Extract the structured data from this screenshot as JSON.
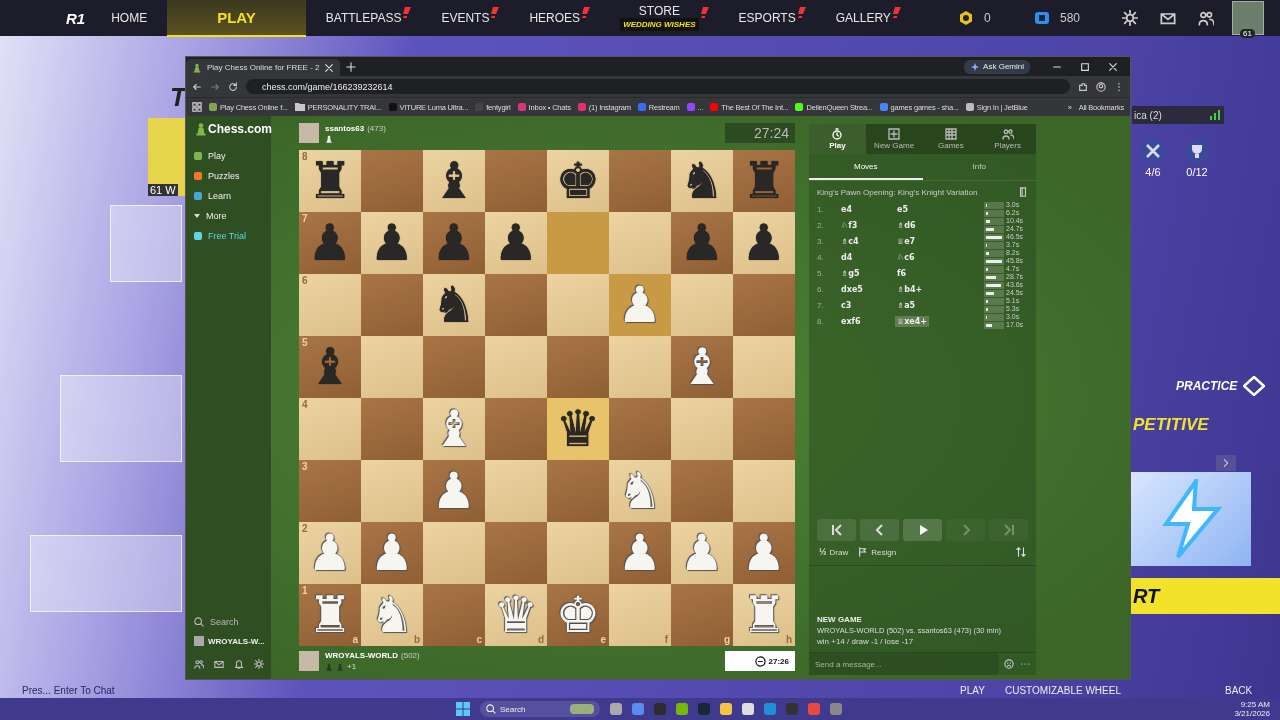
{
  "game_bar": {
    "logo": "R1",
    "nav": [
      {
        "label": "HOME",
        "selected": false,
        "alert": false
      },
      {
        "label": "PLAY",
        "selected": true,
        "alert": false
      },
      {
        "label": "BATTLEPASS",
        "selected": false,
        "alert": true
      },
      {
        "label": "EVENTS",
        "selected": false,
        "alert": true
      },
      {
        "label": "HEROES",
        "selected": false,
        "alert": true
      },
      {
        "label": "STORE",
        "sub": "WEDDING WISHES",
        "selected": false,
        "alert": true
      },
      {
        "label": "ESPORTS",
        "selected": false,
        "alert": true
      },
      {
        "label": "GALLERY",
        "selected": false,
        "alert": true
      }
    ],
    "currencies": [
      "0",
      "580"
    ],
    "level": "61"
  },
  "game_background": {
    "left_letter": "T",
    "left_card": "61 W",
    "friend": "ica (2)",
    "counters": [
      "4/6",
      "0/12"
    ],
    "practice": "PRACTICE",
    "competitive": "PETITIVE",
    "start": "RT",
    "bottom_hints": [
      "Pres... Enter To Chat",
      "PLAY",
      "CUSTOMIZABLE WHEEL",
      "BACK"
    ]
  },
  "browser": {
    "tab_title": "Play Chess Online for FREE - 2",
    "gemini": "Ask Gemini",
    "url": "chess.com/game/166239232614",
    "bookmarks": [
      {
        "label": "Play Chess Online f...",
        "kind": "site",
        "color": "#7fa650"
      },
      {
        "label": "PERSONALITY TRAI...",
        "kind": "folder",
        "color": "#c8c8c8"
      },
      {
        "label": "VITURE Luma Ultra...",
        "kind": "site",
        "color": "#111111"
      },
      {
        "label": "fentygirl",
        "kind": "site",
        "color": "#444444"
      },
      {
        "label": "Inbox • Chats",
        "kind": "site",
        "color": "#d6367a"
      },
      {
        "label": "(1) Instagram",
        "kind": "site",
        "color": "#e1306c"
      },
      {
        "label": "Restream",
        "kind": "site",
        "color": "#3b6cf6"
      },
      {
        "label": "...",
        "kind": "site",
        "color": "#9146ff"
      },
      {
        "label": "The Best Of The Int...",
        "kind": "site",
        "color": "#ff0000"
      },
      {
        "label": "DeilenQueen Strea...",
        "kind": "site",
        "color": "#53fc18"
      },
      {
        "label": "games games - sha...",
        "kind": "site",
        "color": "#4285f4"
      },
      {
        "label": "Sign In | JetBlue",
        "kind": "site",
        "color": "#bbbbbb"
      }
    ],
    "more": "»",
    "all_bookmarks": "All Bookmarks"
  },
  "chess": {
    "logo": "Chess.com",
    "nav": [
      {
        "label": "Play",
        "kind": "play"
      },
      {
        "label": "Puzzles",
        "kind": "puzzles"
      },
      {
        "label": "Learn",
        "kind": "learn"
      },
      {
        "label": "More",
        "kind": "more"
      },
      {
        "label": "Free Trial",
        "kind": "trial"
      }
    ],
    "search": "Search",
    "user": "WROYALS-W...",
    "top_player": {
      "name": "ssantos63",
      "rating": "(473)",
      "clock": "27:24",
      "active": false
    },
    "bottom_player": {
      "name": "WROYALS-WORLD",
      "rating": "(502)",
      "extra": "+1",
      "clock": "27:26",
      "active": true
    },
    "files": [
      "a",
      "b",
      "c",
      "d",
      "e",
      "f",
      "g",
      "h"
    ],
    "ranks": [
      {
        "label": "8",
        "squares": [
          {
            "piece": "♜",
            "white": false,
            "highlighted": false
          },
          {
            "highlighted": false
          },
          {
            "piece": "♝",
            "white": false,
            "highlighted": false
          },
          {
            "highlighted": false
          },
          {
            "piece": "♚",
            "white": false,
            "highlighted": false
          },
          {
            "highlighted": false
          },
          {
            "piece": "♞",
            "white": false,
            "highlighted": false
          },
          {
            "piece": "♜",
            "white": false,
            "highlighted": false
          }
        ]
      },
      {
        "label": "7",
        "squares": [
          {
            "piece": "♟",
            "white": false,
            "highlighted": false
          },
          {
            "piece": "♟",
            "white": false,
            "highlighted": false
          },
          {
            "piece": "♟",
            "white": false,
            "highlighted": false
          },
          {
            "piece": "♟",
            "white": false,
            "highlighted": false
          },
          {
            "highlighted": true
          },
          {
            "highlighted": false
          },
          {
            "piece": "♟",
            "white": false,
            "highlighted": false
          },
          {
            "piece": "♟",
            "white": false,
            "highlighted": false
          }
        ]
      },
      {
        "label": "6",
        "squares": [
          {
            "highlighted": false
          },
          {
            "highlighted": false
          },
          {
            "piece": "♞",
            "white": false,
            "highlighted": false
          },
          {
            "highlighted": false
          },
          {
            "highlighted": false
          },
          {
            "piece": "♟",
            "white": true,
            "highlighted": true
          },
          {
            "highlighted": false
          },
          {
            "highlighted": false
          }
        ]
      },
      {
        "label": "5",
        "squares": [
          {
            "piece": "♝",
            "white": false,
            "highlighted": false
          },
          {
            "highlighted": false
          },
          {
            "highlighted": false
          },
          {
            "highlighted": false
          },
          {
            "highlighted": false
          },
          {
            "highlighted": false
          },
          {
            "piece": "♝",
            "white": true,
            "highlighted": false
          },
          {
            "highlighted": false
          }
        ]
      },
      {
        "label": "4",
        "squares": [
          {
            "highlighted": false
          },
          {
            "highlighted": false
          },
          {
            "piece": "♝",
            "white": true,
            "highlighted": false
          },
          {
            "highlighted": false
          },
          {
            "piece": "♛",
            "white": false,
            "highlighted": true
          },
          {
            "highlighted": false
          },
          {
            "highlighted": false
          },
          {
            "highlighted": false
          }
        ]
      },
      {
        "label": "3",
        "squares": [
          {
            "highlighted": false
          },
          {
            "highlighted": false
          },
          {
            "piece": "♟",
            "white": true,
            "highlighted": false
          },
          {
            "highlighted": false
          },
          {
            "highlighted": false
          },
          {
            "piece": "♞",
            "white": true,
            "highlighted": false
          },
          {
            "highlighted": false
          },
          {
            "highlighted": false
          }
        ]
      },
      {
        "label": "2",
        "squares": [
          {
            "piece": "♟",
            "white": true,
            "highlighted": false
          },
          {
            "piece": "♟",
            "white": true,
            "highlighted": false
          },
          {
            "highlighted": false
          },
          {
            "highlighted": false
          },
          {
            "highlighted": false
          },
          {
            "piece": "♟",
            "white": true,
            "highlighted": false
          },
          {
            "piece": "♟",
            "white": true,
            "highlighted": false
          },
          {
            "piece": "♟",
            "white": true,
            "highlighted": false
          }
        ]
      },
      {
        "label": "1",
        "squares": [
          {
            "piece": "♜",
            "white": true,
            "highlighted": false
          },
          {
            "piece": "♞",
            "white": true,
            "highlighted": false
          },
          {
            "highlighted": false
          },
          {
            "piece": "♛",
            "white": true,
            "highlighted": false
          },
          {
            "piece": "♚",
            "white": true,
            "highlighted": false
          },
          {
            "highlighted": false
          },
          {
            "highlighted": false
          },
          {
            "piece": "♜",
            "white": true,
            "highlighted": false
          }
        ]
      }
    ],
    "panel": {
      "tabs": [
        {
          "label": "Play",
          "kind": "play",
          "selected": true
        },
        {
          "label": "New Game",
          "kind": "new",
          "selected": false
        },
        {
          "label": "Games",
          "kind": "games",
          "selected": false
        },
        {
          "label": "Players",
          "kind": "players",
          "selected": false
        }
      ],
      "subtabs": [
        {
          "label": "Moves",
          "selected": true
        },
        {
          "label": "Info",
          "selected": false
        }
      ],
      "opening": "King's Pawn Opening: King's Knight Variation",
      "moves": [
        {
          "no": "1.",
          "white": {
            "san": "e4",
            "selected": false
          },
          "black": {
            "san": "e5",
            "selected": false
          },
          "times": [
            {
              "text": "3.0s",
              "level": 0.06
            },
            {
              "text": "6.2s",
              "level": 0.13
            }
          ]
        },
        {
          "no": "2.",
          "white": {
            "san": "♘f3",
            "selected": false
          },
          "black": {
            "san": "♗d6",
            "selected": false
          },
          "times": [
            {
              "text": "10.4s",
              "level": 0.22
            },
            {
              "text": "24.7s",
              "level": 0.53
            }
          ]
        },
        {
          "no": "3.",
          "white": {
            "san": "♗c4",
            "selected": false
          },
          "black": {
            "san": "♕e7",
            "selected": false
          },
          "times": [
            {
              "text": "46.5s",
              "level": 1
            },
            {
              "text": "3.7s",
              "level": 0.08
            }
          ]
        },
        {
          "no": "4.",
          "white": {
            "san": "d4",
            "selected": false
          },
          "black": {
            "san": "♘c6",
            "selected": false
          },
          "times": [
            {
              "text": "8.2s",
              "level": 0.18
            },
            {
              "text": "45.8s",
              "level": 0.98
            }
          ]
        },
        {
          "no": "5.",
          "white": {
            "san": "♗g5",
            "selected": false
          },
          "black": {
            "san": "f6",
            "selected": false
          },
          "times": [
            {
              "text": "4.7s",
              "level": 0.1
            },
            {
              "text": "28.7s",
              "level": 0.62
            }
          ]
        },
        {
          "no": "6.",
          "white": {
            "san": "dxe5",
            "selected": false
          },
          "black": {
            "san": "♗b4+",
            "selected": false
          },
          "times": [
            {
              "text": "43.6s",
              "level": 0.94
            },
            {
              "text": "24.5s",
              "level": 0.53
            }
          ]
        },
        {
          "no": "7.",
          "white": {
            "san": "c3",
            "selected": false
          },
          "black": {
            "san": "♗a5",
            "selected": false
          },
          "times": [
            {
              "text": "5.1s",
              "level": 0.11
            },
            {
              "text": "5.3s",
              "level": 0.11
            }
          ]
        },
        {
          "no": "8.",
          "white": {
            "san": "exf6",
            "selected": false
          },
          "black": {
            "san": "♕xe4+",
            "selected": true
          },
          "times": [
            {
              "text": "3.0s",
              "level": 0.06
            },
            {
              "text": "17.0s",
              "level": 0.37
            }
          ]
        }
      ],
      "controls": [
        {
          "kind": "first",
          "disabled": false
        },
        {
          "kind": "prev",
          "disabled": false
        },
        {
          "kind": "play",
          "disabled": false
        },
        {
          "kind": "next",
          "disabled": true
        },
        {
          "kind": "last",
          "disabled": true
        }
      ],
      "draw": "Draw",
      "draw_icon": "½",
      "resign": "Resign",
      "chat": {
        "title": "NEW GAME",
        "line": "WROYALS-WORLD (502) vs. ssantos63 (473) (30 min)",
        "stakes": "win +14 / draw -1 / lose -17",
        "placeholder": "Send a message..."
      }
    }
  },
  "taskbar": {
    "search": "Search",
    "time": "9:25 AM",
    "date": "3/21/2026"
  }
}
